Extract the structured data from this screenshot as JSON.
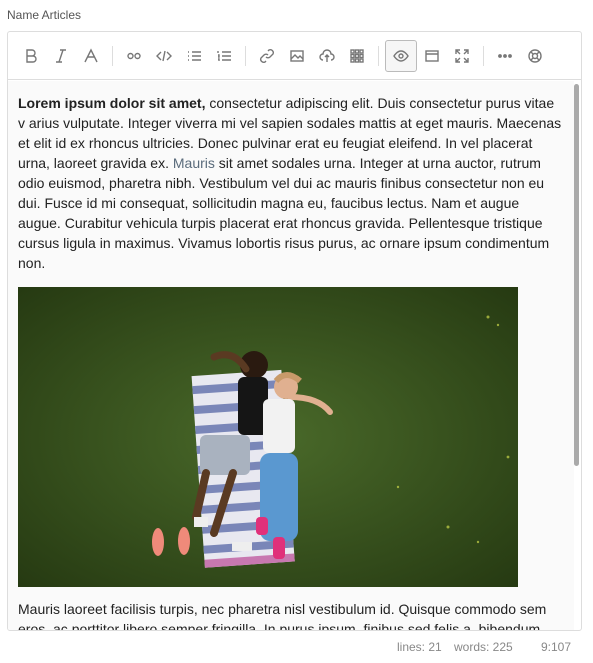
{
  "field": {
    "label": "Name Articles"
  },
  "toolbar": {
    "buttons": [
      {
        "name": "bold-icon"
      },
      {
        "name": "italic-icon"
      },
      {
        "name": "heading-icon"
      },
      {
        "name": "quote-icon"
      },
      {
        "name": "code-icon"
      },
      {
        "name": "unordered-list-icon"
      },
      {
        "name": "ordered-list-icon"
      },
      {
        "name": "link-icon"
      },
      {
        "name": "image-icon"
      },
      {
        "name": "upload-icon"
      },
      {
        "name": "table-icon"
      },
      {
        "name": "preview-eye-icon"
      },
      {
        "name": "side-by-side-icon"
      },
      {
        "name": "fullscreen-icon"
      },
      {
        "name": "more-icon"
      },
      {
        "name": "help-icon"
      }
    ]
  },
  "content": {
    "p1_bold": "Lorem ipsum dolor sit amet,",
    "p1_a": " consectetur adipiscing elit. Duis consectetur purus vitae v arius vulputate. Integer viverra mi vel sapien sodales mattis at eget mauris. Maecenas et elit id ex rhoncus ultricies. Donec pulvinar erat eu feugiat eleifend. In vel placerat urna, laoreet gravida ex. ",
    "p1_link": "Mauris",
    "p1_b": " sit amet sodales urna. Integer at urna auctor, rutrum odio euismod, pharetra nibh. Vestibulum vel dui ac mauris finibus consectetur non eu dui. Fusce id mi consequat, sollicitudin magna eu, faucibus lectus. Nam et augue augue. Curabitur vehicula turpis placerat erat rhoncus gravida. Pellentesque tristique cursus ligula in maximus. Vivamus lobortis risus purus, ac ornare ipsum condimentum non.",
    "p2": "Mauris laoreet facilisis turpis, nec pharetra nisl vestibulum id. Quisque commodo sem eros, ac porttitor libero semper fringilla. In purus ipsum, finibus sed felis a, bibendum"
  },
  "status": {
    "lines": "lines: 21",
    "words": "words: 225",
    "cursor": "9:107"
  }
}
